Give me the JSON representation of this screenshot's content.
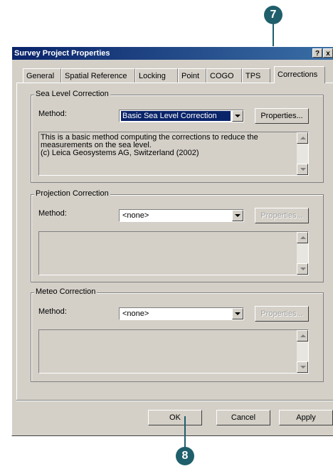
{
  "callouts": {
    "top": "7",
    "bottom": "8"
  },
  "window": {
    "title": "Survey Project Properties",
    "help_glyph": "?",
    "close_glyph": "x"
  },
  "tabs": [
    {
      "label": "General"
    },
    {
      "label": "Spatial Reference"
    },
    {
      "label": "Locking"
    },
    {
      "label": "Point"
    },
    {
      "label": "COGO"
    },
    {
      "label": "TPS"
    },
    {
      "label": "Corrections",
      "active": true
    }
  ],
  "sea_level": {
    "title": "Sea Level Correction",
    "method_label": "Method:",
    "method_value": "Basic Sea Level Correction",
    "properties_label": "Properties...",
    "description": [
      "This is a basic method computing the corrections to reduce the",
      "measurements on the sea level.",
      "(c) Leica Geosystems AG, Switzerland (2002)"
    ]
  },
  "projection": {
    "title": "Projection Correction",
    "method_label": "Method:",
    "method_value": "<none>",
    "properties_label": "Properties..."
  },
  "meteo": {
    "title": "Meteo Correction",
    "method_label": "Method:",
    "method_value": "<none>",
    "properties_label": "Properties..."
  },
  "footer": {
    "ok_label": "OK",
    "cancel_label": "Cancel",
    "apply_label": "Apply"
  }
}
